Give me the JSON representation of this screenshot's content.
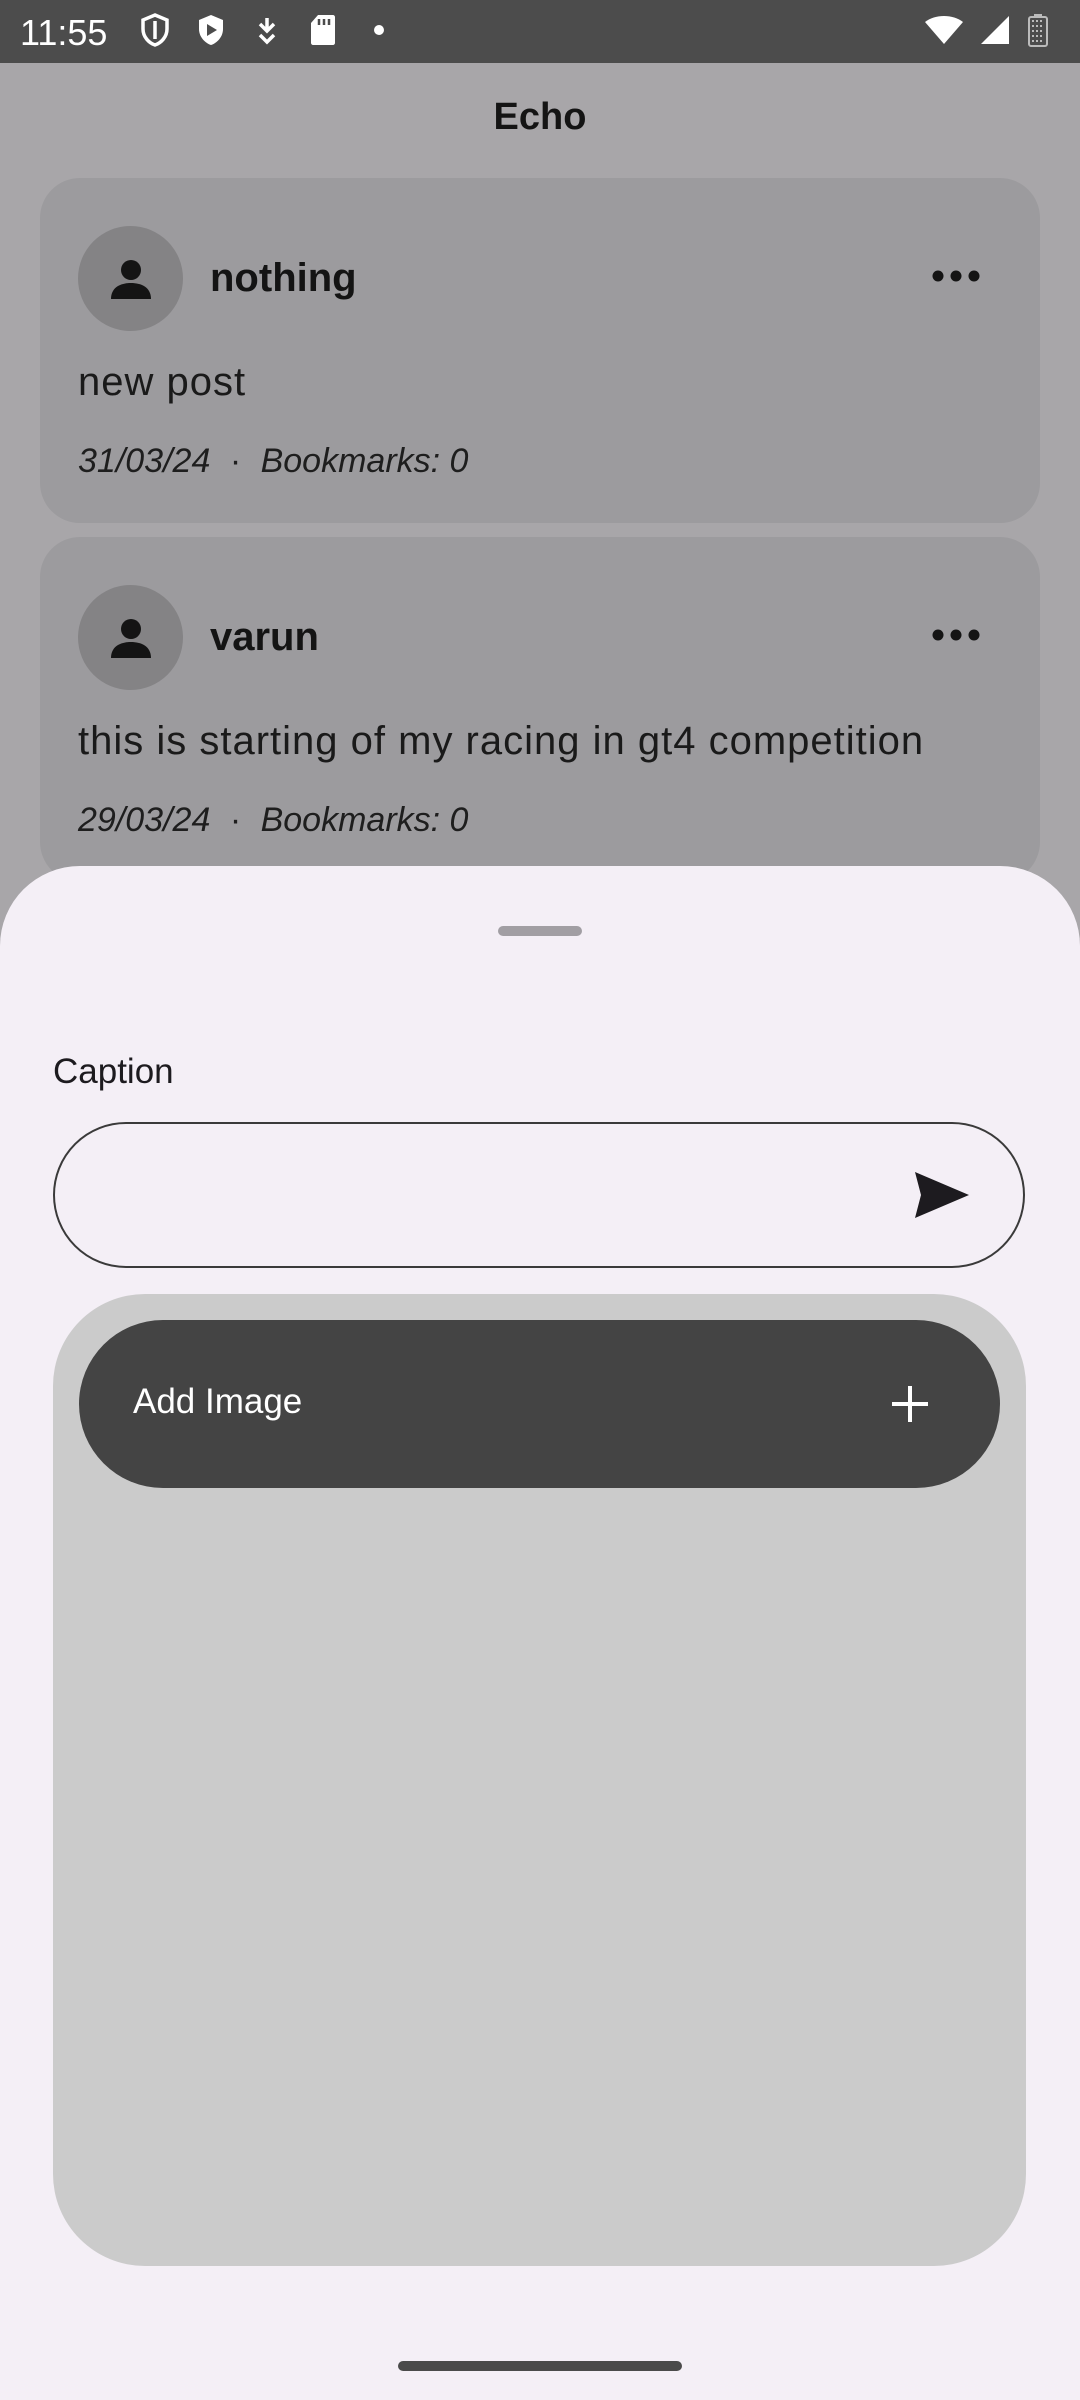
{
  "status_bar": {
    "time": "11:55",
    "icons_left": [
      "shield-outline-icon",
      "shield-play-icon",
      "download-icon",
      "sd-card-icon",
      "dot-icon"
    ],
    "icons_right": [
      "wifi-icon",
      "signal-icon",
      "battery-icon"
    ]
  },
  "app": {
    "title": "Echo"
  },
  "posts": [
    {
      "username": "nothing",
      "text": "new post",
      "date": "31/03/24",
      "separator": "·",
      "bookmarks": "Bookmarks: 0"
    },
    {
      "username": "varun",
      "text": "this is starting of my racing in gt4 competition",
      "date": "29/03/24",
      "separator": "·",
      "bookmarks": "Bookmarks: 0"
    }
  ],
  "sheet": {
    "caption_label": "Caption",
    "caption_value": "",
    "add_image_label": "Add Image"
  },
  "colors": {
    "status_bar_bg": "#4c4c4c",
    "scrim_bg": "#a8a6a9",
    "sheet_bg": "#f4eff6",
    "add_image_button": "#444444",
    "image_area": "#cbcbcb"
  }
}
